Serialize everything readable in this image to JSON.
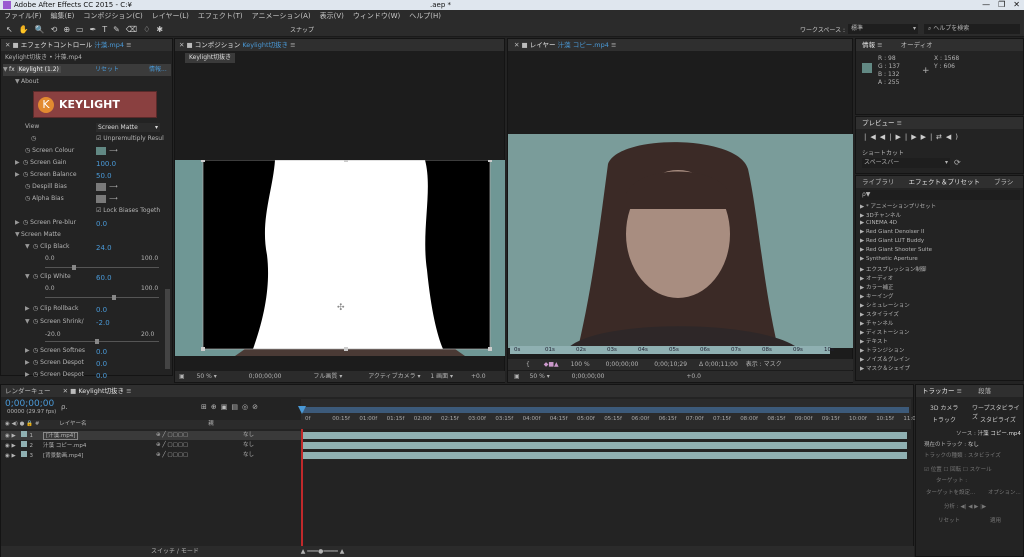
{
  "window": {
    "title": "Adobe After Effects CC 2015 - C:¥",
    "title_right": ".aep *"
  },
  "menu": [
    "ファイル(F)",
    "編集(E)",
    "コンポジション(C)",
    "レイヤー(L)",
    "エフェクト(T)",
    "アニメーション(A)",
    "表示(V)",
    "ウィンドウ(W)",
    "ヘルプ(H)"
  ],
  "toolbar": {
    "snap_label": "スナップ",
    "workspace_label": "ワークスペース :",
    "workspace_value": "標準",
    "help_placeholder": "ヘルプを検索"
  },
  "effect_panel": {
    "tab_label": "エフェクトコントロール",
    "tab_target": "汁藻.mp4",
    "breadcrumb": "Keylight切抜き • 汁藻.mp4",
    "effect_name": "Keylight (1.2)",
    "reset": "リセット",
    "info": "情報...",
    "about": "About",
    "logo_text": "KEYLIGHT",
    "view_label": "View",
    "view_value": "Screen Matte",
    "unpremultiply": "Unpremultiply Resul",
    "screen_colour": "Screen Colour",
    "screen_gain": "Screen Gain",
    "screen_gain_value": "100.0",
    "screen_balance": "Screen Balance",
    "screen_balance_value": "50.0",
    "despill_bias": "Despill Bias",
    "alpha_bias": "Alpha Bias",
    "lock_biases": "Lock Biases Togeth",
    "screen_preblur": "Screen Pre-blur",
    "screen_preblur_value": "0.0",
    "screen_matte": "Screen Matte",
    "clip_black": "Clip Black",
    "clip_black_value": "24.0",
    "clip_black_min": "0.0",
    "clip_black_max": "100.0",
    "clip_white": "Clip White",
    "clip_white_value": "60.0",
    "clip_white_min": "0.0",
    "clip_white_max": "100.0",
    "clip_rollback": "Clip Rollback",
    "clip_rollback_value": "0.0",
    "screen_shrink": "Screen Shrink/",
    "screen_shrink_value": "-2.0",
    "screen_shrink_min": "-20.0",
    "screen_shrink_max": "20.0",
    "screen_softness": "Screen Softnes",
    "screen_softness_value": "0.0",
    "screen_despot1": "Screen Despot",
    "screen_despot1_value": "0.0",
    "screen_despot2": "Screen Despot",
    "screen_despot2_value": "0.0"
  },
  "comp_panel": {
    "tab_label": "コンポジション",
    "tab_target": "Keylight切抜き",
    "subtab": "Keylight切抜き",
    "zoom": "50 %",
    "timecode": "0;00;00;00",
    "quality": "フル画質",
    "camera": "アクティブカメラ",
    "views": "1 画面",
    "offset": "+0.0"
  },
  "layer_panel": {
    "tab_label": "レイヤー",
    "tab_target": "汁藻 コピー.mp4",
    "ruler": [
      "0s",
      "01s",
      "02s",
      "03s",
      "04s",
      "05s",
      "06s",
      "07s",
      "08s",
      "09s",
      "10s"
    ],
    "zoom": "50 %",
    "tc_start": "0;00;00;00",
    "tc_end": "0;00;10;29",
    "tc_dur": "Δ 0;00;11;00",
    "view_label": "表示 :",
    "view_value": "マスク",
    "percent": "100 %",
    "offset": "+0.0"
  },
  "info_panel": {
    "tab_info": "情報",
    "tab_audio": "オーディオ",
    "r": "R : 98",
    "g": "G : 137",
    "b": "B : 132",
    "a": "A : 255",
    "x": "X : 1568",
    "y": "Y : 606",
    "swatch_color": "#628984"
  },
  "preview_panel": {
    "title": "プレビュー",
    "shortcut_label": "ショートカット",
    "shortcut_value": "スペースバー"
  },
  "effects_panel": {
    "tabs": [
      "ライブラリ",
      "エフェクト＆プリセット",
      "ブラシ"
    ],
    "search_placeholder": "ρ▼",
    "items": [
      "* アニメーションプリセット",
      "3Dチャンネル",
      "CINEMA 4D",
      "Red Giant Denoiser II",
      "Red Giant LUT Buddy",
      "Red Giant Shooter Suite",
      "Synthetic Aperture",
      "エクスプレッション制御",
      "オーディオ",
      "カラー補正",
      "キーイング",
      "シミュレーション",
      "スタイライズ",
      "チャンネル",
      "ディストーション",
      "テキスト",
      "トランジション",
      "ノイズ＆グレイン",
      "マスク＆シェイプ"
    ]
  },
  "timeline": {
    "tab_render": "レンダーキュー",
    "tab_comp": "Keylight切抜き",
    "timecode": "0;00;00;00",
    "fps": "00000 (29.97 fps)",
    "col_layer": "レイヤー名",
    "col_parent": "親",
    "layers": [
      {
        "num": "1",
        "name": "[汁藻.mp4]",
        "parent": "なし"
      },
      {
        "num": "2",
        "name": "汁藻 コピー.mp4",
        "parent": "なし"
      },
      {
        "num": "3",
        "name": "[背景動画.mp4]",
        "parent": "なし"
      }
    ],
    "ruler": [
      "0f",
      "00:15f",
      "01:00f",
      "01:15f",
      "02:00f",
      "02:15f",
      "03:00f",
      "03:15f",
      "04:00f",
      "04:15f",
      "05:00f",
      "05:15f",
      "06:00f",
      "06:15f",
      "07:00f",
      "07:15f",
      "08:00f",
      "08:15f",
      "09:00f",
      "09:15f",
      "10:00f",
      "10:15f",
      "11:00"
    ],
    "footer": "スイッチ / モード"
  },
  "tracker": {
    "tab": "トラッカー",
    "tab2": "段落",
    "btn_3d": "3D カメラ",
    "btn_warp": "ワープスタビライズ",
    "btn_track": "トラック",
    "btn_stabilize": "スタビライズ",
    "source_label": "ソース :",
    "source_value": "汁藻 コピー.mp4",
    "current_label": "現在のトラック :",
    "current_value": "なし",
    "type_label": "トラックの種類 :",
    "type_value": "スタビライズ",
    "position": "位置",
    "rotation": "回転",
    "scale": "スケール",
    "target": "ターゲット :",
    "edit_target": "ターゲットを設定...",
    "options": "オプション...",
    "analyze": "分析 :",
    "reset": "リセット",
    "apply": "適用"
  }
}
